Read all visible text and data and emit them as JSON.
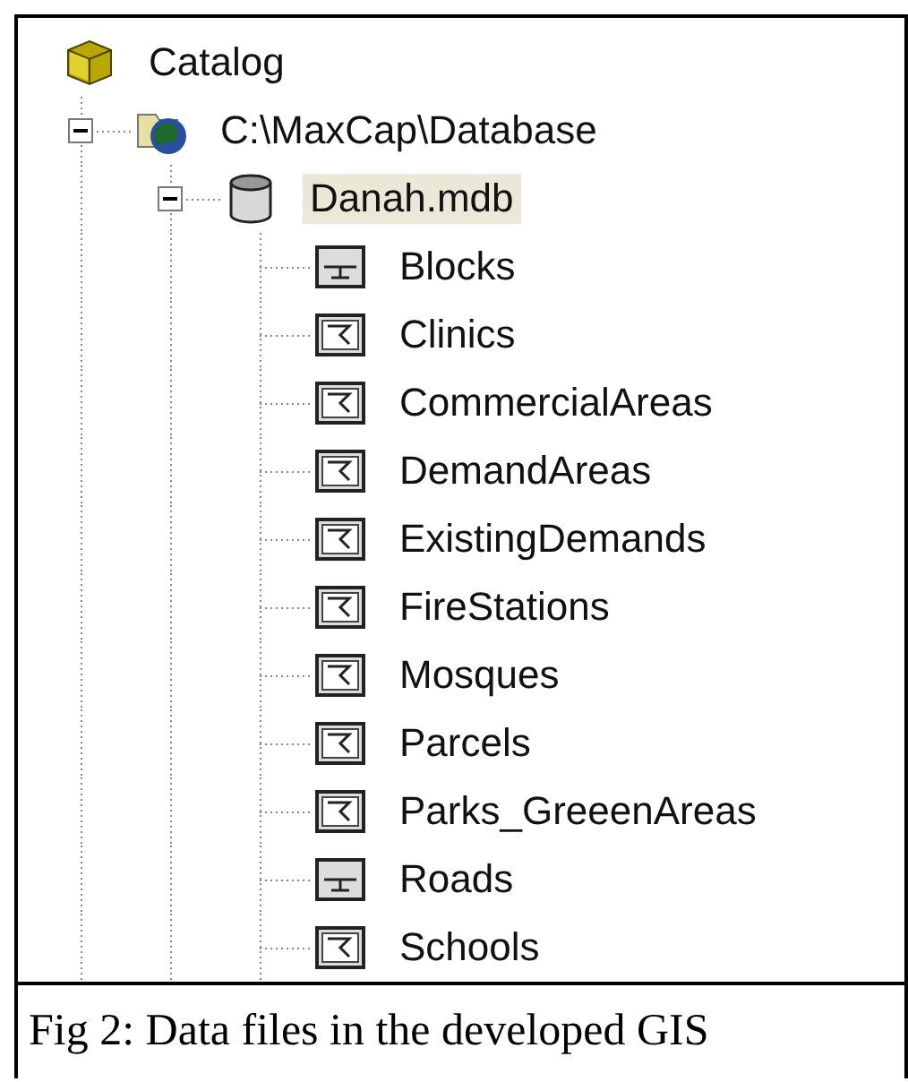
{
  "tree": [
    {
      "label": "Catalog",
      "kind": "catalog",
      "selected": false,
      "children": [
        {
          "label": "C:\\MaxCap\\Database",
          "kind": "folder",
          "expanded": true,
          "selected": false,
          "children": [
            {
              "label": "Danah.mdb",
              "kind": "database",
              "expanded": true,
              "selected": true,
              "children": [
                {
                  "label": "Blocks",
                  "kind": "line",
                  "selected": false
                },
                {
                  "label": "Clinics",
                  "kind": "polygon",
                  "selected": false
                },
                {
                  "label": "CommercialAreas",
                  "kind": "polygon",
                  "selected": false
                },
                {
                  "label": "DemandAreas",
                  "kind": "polygon",
                  "selected": false
                },
                {
                  "label": "ExistingDemands",
                  "kind": "polygon",
                  "selected": false
                },
                {
                  "label": "FireStations",
                  "kind": "polygon",
                  "selected": false
                },
                {
                  "label": "Mosques",
                  "kind": "polygon",
                  "selected": false
                },
                {
                  "label": "Parcels",
                  "kind": "polygon",
                  "selected": false
                },
                {
                  "label": "Parks_GreeenAreas",
                  "kind": "polygon",
                  "selected": false
                },
                {
                  "label": "Roads",
                  "kind": "line",
                  "selected": false
                },
                {
                  "label": "Schools",
                  "kind": "polygon",
                  "selected": false
                }
              ]
            }
          ]
        }
      ]
    }
  ],
  "caption": "Fig 2: Data files in the developed GIS"
}
